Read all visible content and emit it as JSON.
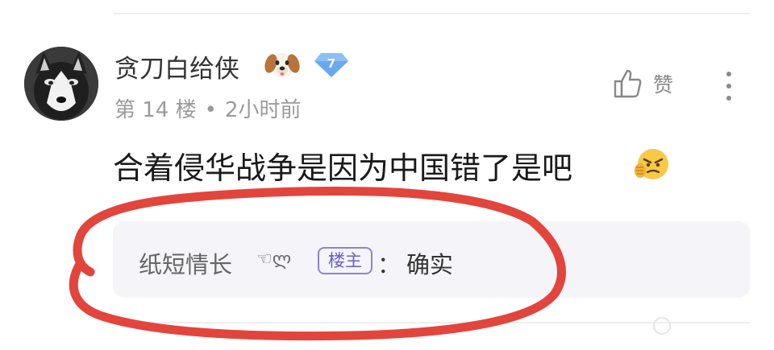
{
  "comment": {
    "username": "贪刀白给侠",
    "level": "7",
    "floor": "第 14 楼",
    "separator": "•",
    "time": "2小时前",
    "text": "合着侵华战争是因为中国错了是吧",
    "like_label": "赞",
    "emoji_after_name": "dog-face",
    "emoji_after_text": "angry-face"
  },
  "reply": {
    "user": "纸短情长",
    "user_decoration": "☜ლ",
    "badge": "楼主",
    "colon": "：",
    "text": "确实"
  },
  "colors": {
    "badge_gem": "#6aa8ef",
    "op_badge": "#8e82d6",
    "annotation_circle": "#e2453c",
    "reply_bg": "#f4f4f9"
  }
}
